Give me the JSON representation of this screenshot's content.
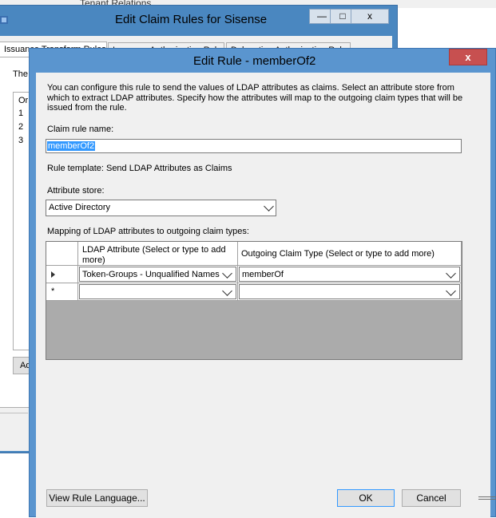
{
  "background": {
    "tree_item": "Tenant Relations...",
    "edit_claim_rules": {
      "title": "Edit Claim Rules for Sisense",
      "tabs": [
        "Issuance Transform Rules",
        "Issuance Authorization Rules",
        "Delegation Authorization Rules"
      ],
      "description": "The",
      "list_header": "Or",
      "rows": [
        "1",
        "2",
        "3"
      ],
      "add_button": "Ad"
    }
  },
  "dialog": {
    "title": "Edit Rule - memberOf2",
    "close_glyph": "x",
    "intro": "You can configure this rule to send the values of LDAP attributes as claims. Select an attribute store from which to extract LDAP attributes. Specify how the attributes will map to the outgoing claim types that will be issued from the rule.",
    "claim_rule_name_label": "Claim rule name:",
    "claim_rule_name_value": "memberOf2",
    "rule_template": "Rule template: Send LDAP Attributes as Claims",
    "attribute_store_label": "Attribute store:",
    "attribute_store_value": "Active Directory",
    "mapping_label": "Mapping of LDAP attributes to outgoing claim types:",
    "grid": {
      "columns": [
        "LDAP Attribute (Select or type to add more)",
        "Outgoing Claim Type (Select or type to add more)"
      ],
      "rows": [
        {
          "ldap_attribute": "Token-Groups - Unqualified Names",
          "claim_type": "memberOf"
        },
        {
          "ldap_attribute": "",
          "claim_type": ""
        }
      ],
      "new_row_marker": "*"
    },
    "buttons": {
      "view_rule_language": "View Rule Language...",
      "ok": "OK",
      "cancel": "Cancel"
    }
  },
  "window_controls": {
    "minimize": "—",
    "maximize": "□",
    "close": "x"
  },
  "colors": {
    "title_bar": "#5a95cf",
    "close_button": "#c75050",
    "selection": "#3399ff"
  }
}
